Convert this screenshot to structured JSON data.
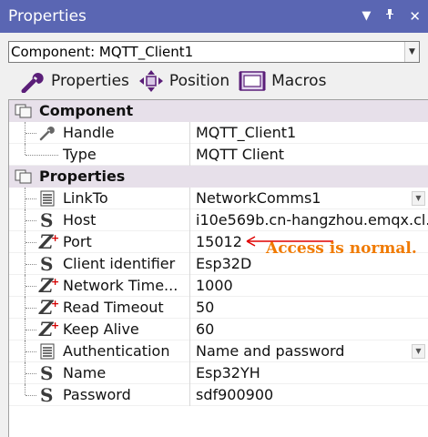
{
  "window": {
    "title": "Properties",
    "dropdown_icon": "chevron-down-icon",
    "pin_icon": "pin-icon",
    "close_icon": "close-icon"
  },
  "component_select": {
    "value": "Component: MQTT_Client1"
  },
  "tabs": [
    {
      "label": "Properties",
      "icon": "wrench-icon"
    },
    {
      "label": "Position",
      "icon": "move-arrows-icon"
    },
    {
      "label": "Macros",
      "icon": "macro-icon"
    }
  ],
  "categories": {
    "component": {
      "label": "Component"
    },
    "properties": {
      "label": "Properties"
    }
  },
  "component_rows": [
    {
      "name": "Handle",
      "value": "MQTT_Client1"
    },
    {
      "name": "Type",
      "value": "MQTT Client"
    }
  ],
  "property_rows": [
    {
      "name": "LinkTo",
      "value": "NetworkComms1",
      "type": "list",
      "dropdown": true
    },
    {
      "name": "Host",
      "value": "i10e569b.cn-hangzhou.emqx.cl...",
      "type": "string"
    },
    {
      "name": "Port",
      "value": "15012",
      "type": "integer"
    },
    {
      "name": "Client identifier",
      "value": "Esp32D",
      "type": "string"
    },
    {
      "name": "Network Time...",
      "value": "1000",
      "type": "integer"
    },
    {
      "name": "Read Timeout",
      "value": "50",
      "type": "integer"
    },
    {
      "name": "Keep Alive",
      "value": "60",
      "type": "integer"
    },
    {
      "name": "Authentication",
      "value": "Name and password",
      "type": "list",
      "dropdown": true
    },
    {
      "name": "Name",
      "value": "Esp32YH",
      "type": "string"
    },
    {
      "name": "Password",
      "value": "sdf900900",
      "type": "string"
    }
  ],
  "annotation": {
    "text": "Access is normal.",
    "color": "#f07a00",
    "arrow_color": "#e00000"
  },
  "colors": {
    "titlebar": "#5a66b3",
    "category_bg": "#e7e0ea"
  }
}
